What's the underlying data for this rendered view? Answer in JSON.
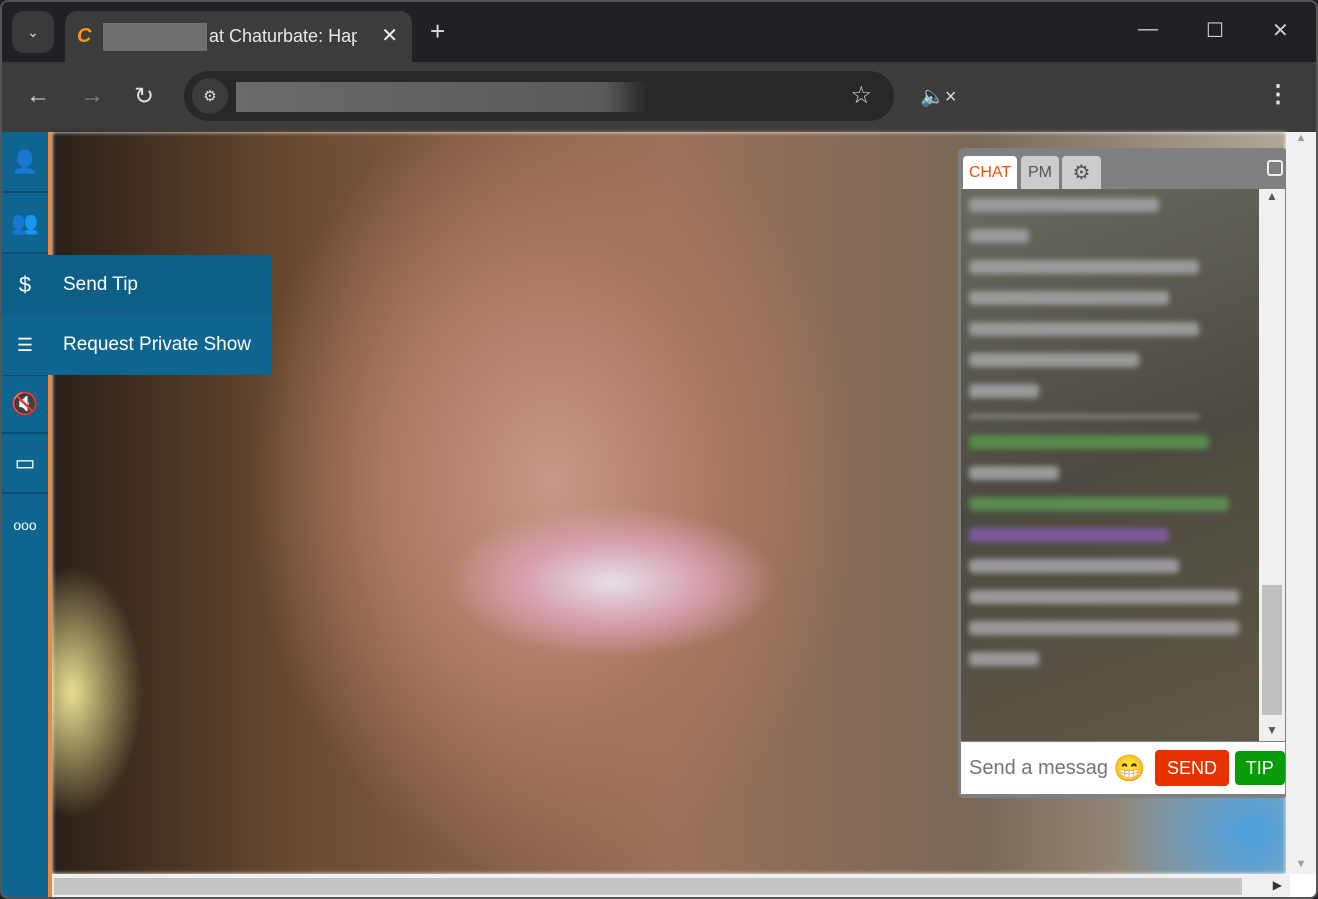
{
  "browser": {
    "tab_title": "at Chaturbate: Hap",
    "new_tab": "+",
    "close_tab": "✕"
  },
  "sidebar": {
    "items": [
      {
        "icon": "user-icon"
      },
      {
        "icon": "users-icon"
      },
      {
        "icon": "dollar-icon",
        "label": "Send Tip"
      },
      {
        "icon": "contact-list-icon",
        "label": "Request Private Show"
      },
      {
        "icon": "speaker-muted-icon"
      },
      {
        "icon": "video-camera-icon"
      },
      {
        "icon": "more-icon"
      }
    ]
  },
  "chat": {
    "tabs": {
      "chat": "CHAT",
      "pm": "PM"
    },
    "active_tab_color": "#e8520b",
    "input_placeholder": "Send a message",
    "send_label": "SEND",
    "tip_label": "TIP",
    "send_color": "#e73200",
    "tip_color": "#089c09"
  },
  "colors": {
    "sidebar": "#0e6590",
    "accent": "#f0893a"
  }
}
